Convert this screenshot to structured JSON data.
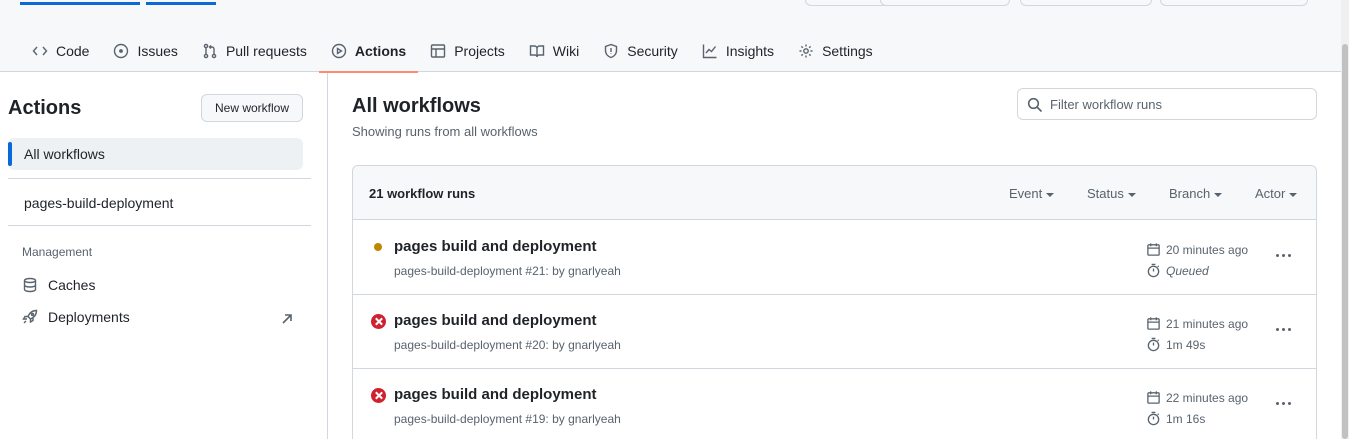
{
  "repo_nav": [
    {
      "label": "Code",
      "icon": "code-icon"
    },
    {
      "label": "Issues",
      "icon": "issue-icon"
    },
    {
      "label": "Pull requests",
      "icon": "pull-request-icon"
    },
    {
      "label": "Actions",
      "icon": "play-icon",
      "active": true
    },
    {
      "label": "Projects",
      "icon": "table-icon"
    },
    {
      "label": "Wiki",
      "icon": "book-icon"
    },
    {
      "label": "Security",
      "icon": "shield-icon"
    },
    {
      "label": "Insights",
      "icon": "graph-icon"
    },
    {
      "label": "Settings",
      "icon": "gear-icon"
    }
  ],
  "sidebar": {
    "title": "Actions",
    "new_workflow_label": "New workflow",
    "all_workflows_label": "All workflows",
    "workflow_item": "pages-build-deployment",
    "management_label": "Management",
    "caches_label": "Caches",
    "deployments_label": "Deployments"
  },
  "main": {
    "title": "All workflows",
    "subtitle": "Showing runs from all workflows",
    "filter_placeholder": "Filter workflow runs",
    "runs_count": "21 workflow runs",
    "filters": {
      "event": "Event",
      "status": "Status",
      "branch": "Branch",
      "actor": "Actor"
    },
    "runs": [
      {
        "title": "pages build and deployment",
        "meta": "pages-build-deployment #21: by gnarlyeah",
        "time_ago": "20 minutes ago",
        "duration": "Queued",
        "status": "queued"
      },
      {
        "title": "pages build and deployment",
        "meta": "pages-build-deployment #20: by gnarlyeah",
        "time_ago": "21 minutes ago",
        "duration": "1m 49s",
        "status": "failed"
      },
      {
        "title": "pages build and deployment",
        "meta": "pages-build-deployment #19: by gnarlyeah",
        "time_ago": "22 minutes ago",
        "duration": "1m 16s",
        "status": "failed"
      }
    ]
  },
  "colors": {
    "accent": "#0969da",
    "tab_underline": "#fd8c73",
    "queued": "#bf8700",
    "failed": "#cf222e"
  }
}
